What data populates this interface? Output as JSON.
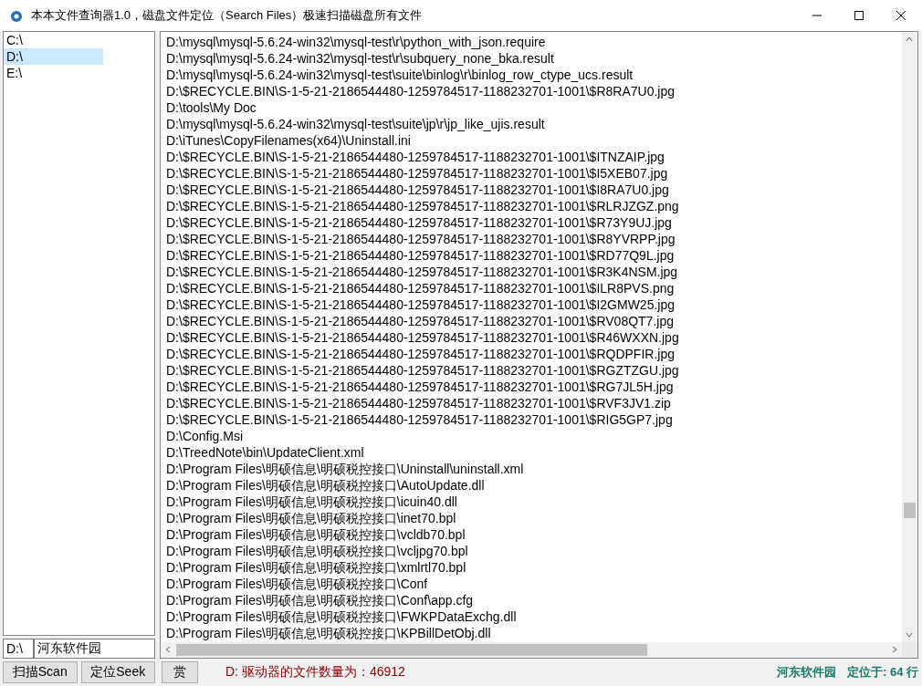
{
  "window": {
    "title": "本本文件查询器1.0，磁盘文件定位（Search Files）极速扫描磁盘所有文件"
  },
  "drives": [
    {
      "label": "C:\\",
      "selected": false
    },
    {
      "label": "D:\\",
      "selected": true
    },
    {
      "label": "E:\\",
      "selected": false
    }
  ],
  "drive_field": {
    "value": "D:\\"
  },
  "keyword_field": {
    "value": "河东软件园"
  },
  "buttons": [
    "扫描Scan",
    "定位Seek"
  ],
  "files": [
    "D:\\mysql\\mysql-5.6.24-win32\\mysql-test\\r\\python_with_json.require",
    "D:\\mysql\\mysql-5.6.24-win32\\mysql-test\\r\\subquery_none_bka.result",
    "D:\\mysql\\mysql-5.6.24-win32\\mysql-test\\suite\\binlog\\r\\binlog_row_ctype_ucs.result",
    "D:\\$RECYCLE.BIN\\S-1-5-21-2186544480-1259784517-1188232701-1001\\$R8RA7U0.jpg",
    "D:\\tools\\My Doc",
    "D:\\mysql\\mysql-5.6.24-win32\\mysql-test\\suite\\jp\\r\\jp_like_ujis.result",
    "D:\\iTunes\\CopyFilenames(x64)\\Uninstall.ini",
    "D:\\$RECYCLE.BIN\\S-1-5-21-2186544480-1259784517-1188232701-1001\\$ITNZAIP.jpg",
    "D:\\$RECYCLE.BIN\\S-1-5-21-2186544480-1259784517-1188232701-1001\\$I5XEB07.jpg",
    "D:\\$RECYCLE.BIN\\S-1-5-21-2186544480-1259784517-1188232701-1001\\$I8RA7U0.jpg",
    "D:\\$RECYCLE.BIN\\S-1-5-21-2186544480-1259784517-1188232701-1001\\$RLRJZGZ.png",
    "D:\\$RECYCLE.BIN\\S-1-5-21-2186544480-1259784517-1188232701-1001\\$R73Y9UJ.jpg",
    "D:\\$RECYCLE.BIN\\S-1-5-21-2186544480-1259784517-1188232701-1001\\$R8YVRPP.jpg",
    "D:\\$RECYCLE.BIN\\S-1-5-21-2186544480-1259784517-1188232701-1001\\$RD77Q9L.jpg",
    "D:\\$RECYCLE.BIN\\S-1-5-21-2186544480-1259784517-1188232701-1001\\$R3K4NSM.jpg",
    "D:\\$RECYCLE.BIN\\S-1-5-21-2186544480-1259784517-1188232701-1001\\$ILR8PVS.png",
    "D:\\$RECYCLE.BIN\\S-1-5-21-2186544480-1259784517-1188232701-1001\\$I2GMW25.jpg",
    "D:\\$RECYCLE.BIN\\S-1-5-21-2186544480-1259784517-1188232701-1001\\$RV08QT7.jpg",
    "D:\\$RECYCLE.BIN\\S-1-5-21-2186544480-1259784517-1188232701-1001\\$R46WXXN.jpg",
    "D:\\$RECYCLE.BIN\\S-1-5-21-2186544480-1259784517-1188232701-1001\\$RQDPFIR.jpg",
    "D:\\$RECYCLE.BIN\\S-1-5-21-2186544480-1259784517-1188232701-1001\\$RGZTZGU.jpg",
    "D:\\$RECYCLE.BIN\\S-1-5-21-2186544480-1259784517-1188232701-1001\\$RG7JL5H.jpg",
    "D:\\$RECYCLE.BIN\\S-1-5-21-2186544480-1259784517-1188232701-1001\\$RVF3JV1.zip",
    "D:\\$RECYCLE.BIN\\S-1-5-21-2186544480-1259784517-1188232701-1001\\$RIG5GP7.jpg",
    "D:\\Config.Msi",
    "D:\\TreedNote\\bin\\UpdateClient.xml",
    "D:\\Program Files\\明硕信息\\明硕税控接口\\Uninstall\\uninstall.xml",
    "D:\\Program Files\\明硕信息\\明硕税控接口\\AutoUpdate.dll",
    "D:\\Program Files\\明硕信息\\明硕税控接口\\icuin40.dll",
    "D:\\Program Files\\明硕信息\\明硕税控接口\\inet70.bpl",
    "D:\\Program Files\\明硕信息\\明硕税控接口\\vcldb70.bpl",
    "D:\\Program Files\\明硕信息\\明硕税控接口\\vcljpg70.bpl",
    "D:\\Program Files\\明硕信息\\明硕税控接口\\xmlrtl70.bpl",
    "D:\\Program Files\\明硕信息\\明硕税控接口\\Conf",
    "D:\\Program Files\\明硕信息\\明硕税控接口\\Conf\\app.cfg",
    "D:\\Program Files\\明硕信息\\明硕税控接口\\FWKPDataExchg.dll",
    "D:\\Program Files\\明硕信息\\明硕税控接口\\KPBillDetObj.dll"
  ],
  "status_bar": {
    "reward_button": "赏",
    "file_count": "D: 驱动器的文件数量为：46912",
    "brand": "河东软件园",
    "position": "定位于: 64 行"
  }
}
